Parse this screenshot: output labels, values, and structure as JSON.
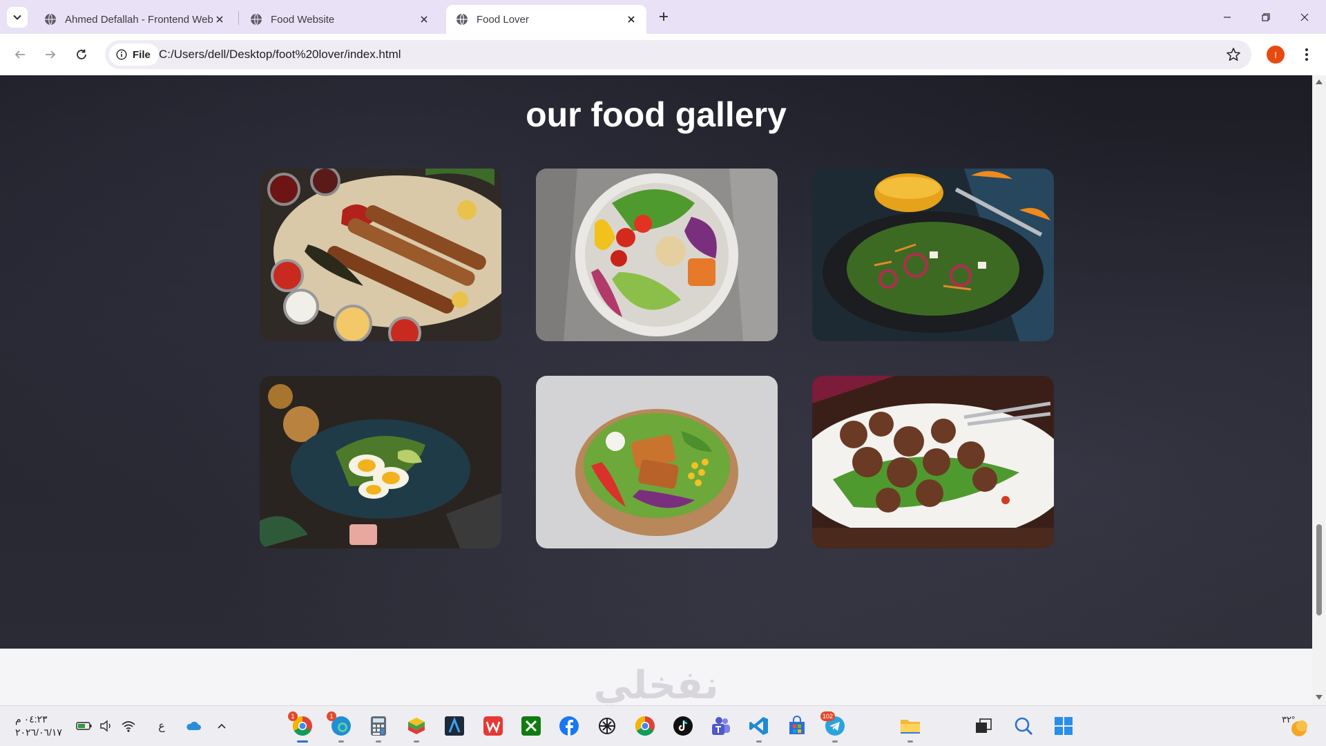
{
  "browser": {
    "tabs": [
      {
        "title": "Ahmed Defallah - Frontend Web",
        "active": false
      },
      {
        "title": "Food Website",
        "active": false
      },
      {
        "title": "Food Lover",
        "active": true
      }
    ],
    "site_chip_label": "File",
    "url": "C:/Users/dell/Desktop/foot%20lover/index.html",
    "profile_initial": "I",
    "accent": "#e8490f"
  },
  "page": {
    "gallery_title": "our food gallery",
    "gallery_items": [
      {
        "subject": "grilled kebab platter"
      },
      {
        "subject": "fresh vegetable salad bowl"
      },
      {
        "subject": "green salad with orange juice"
      },
      {
        "subject": "egg and avocado salad"
      },
      {
        "subject": "chicken salad bowl"
      },
      {
        "subject": "meatballs on arugula"
      }
    ],
    "watermark": "نفخلي"
  },
  "taskbar": {
    "time": "٠٤:٢٣ م",
    "date": "٢٠٢٦/٠٦/١٧",
    "language": "ع",
    "temperature": "٣٢°",
    "badges": {
      "chrome": "1",
      "edge": "1",
      "telegram": "102"
    }
  }
}
